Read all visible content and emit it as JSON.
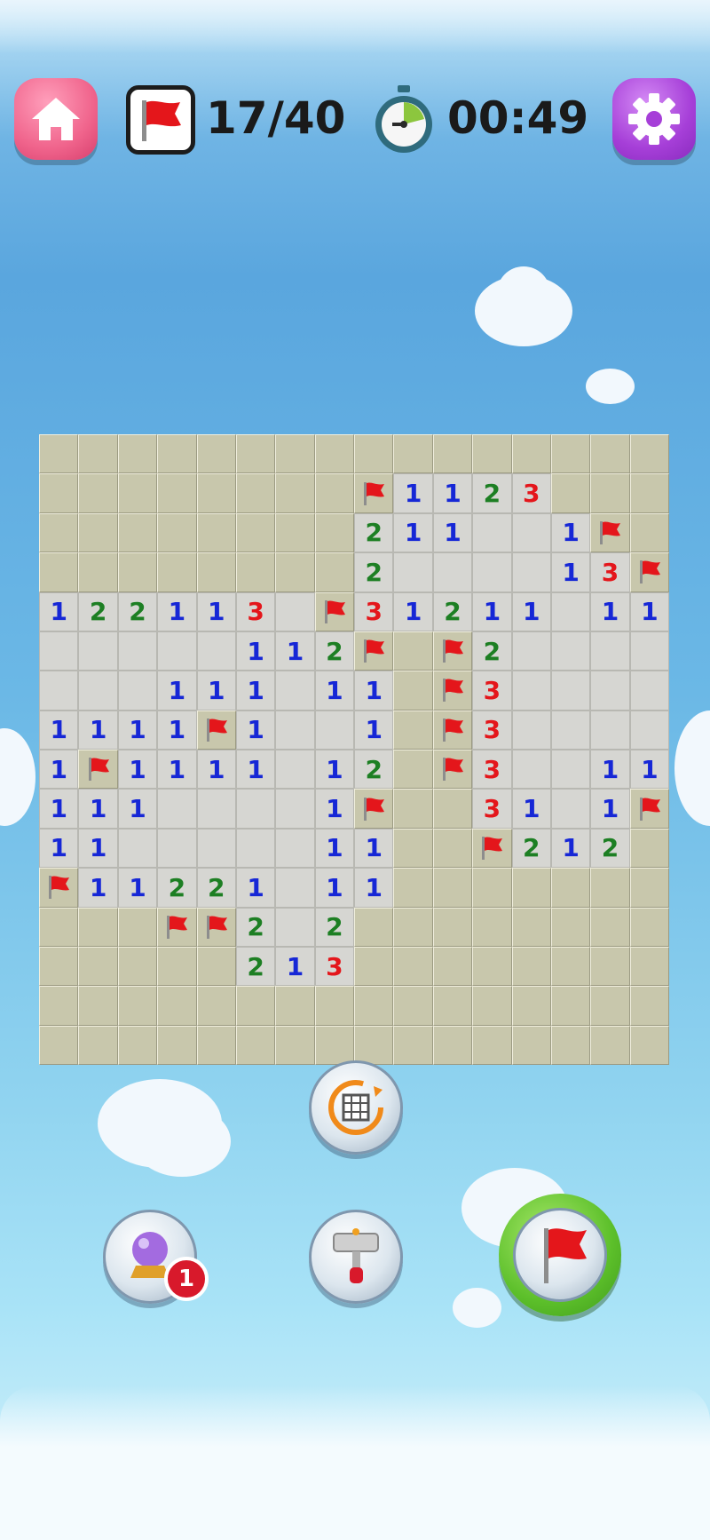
{
  "hud": {
    "flags_label": "17/40",
    "timer_label": "00:49"
  },
  "colors": {
    "home_button": "#f0648c",
    "settings_button": "#a63fd8",
    "num1": "#1627d6",
    "num2": "#1d7f23",
    "num3": "#e4161b",
    "flag": "#e4161b",
    "covered_tile": "#c8c7ac",
    "open_tile": "#d6d6d2"
  },
  "board": {
    "cols": 16,
    "rows": 16,
    "grid": [
      "################",
      "########F1123###",
      "########211  1F#",
      "########2    13F#",
      "1221130F31211 111",
      "     112F#F2     ",
      "   111 11#F3     ",
      "1111F1  1#F3     ",
      "1F1111 12#F3  11",
      "111    1F##31 1F",
      "11     11##F212#",
      "F11221 11#######",
      "###FF2 2########",
      "#####213########",
      "################",
      "################"
    ]
  },
  "toolbar": {
    "hint_badge": "1"
  },
  "icons": {
    "home": "home-icon",
    "flag": "flag-icon",
    "stopwatch": "stopwatch-icon",
    "settings": "gear-icon",
    "reset_board": "reset-grid-icon",
    "crystal_ball": "crystal-ball-icon",
    "hammer": "hammer-icon",
    "flag_mode": "flag-mode-icon"
  }
}
